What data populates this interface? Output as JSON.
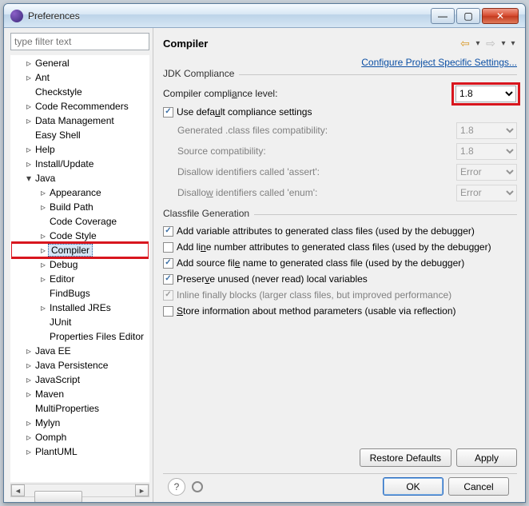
{
  "window": {
    "title": "Preferences"
  },
  "filter": {
    "placeholder": "type filter text"
  },
  "tree": {
    "items": [
      {
        "label": "General",
        "caret": ">",
        "depth": 1
      },
      {
        "label": "Ant",
        "caret": ">",
        "depth": 1
      },
      {
        "label": "Checkstyle",
        "caret": "",
        "depth": 1
      },
      {
        "label": "Code Recommenders",
        "caret": ">",
        "depth": 1
      },
      {
        "label": "Data Management",
        "caret": ">",
        "depth": 1
      },
      {
        "label": "Easy Shell",
        "caret": "",
        "depth": 1
      },
      {
        "label": "Help",
        "caret": ">",
        "depth": 1
      },
      {
        "label": "Install/Update",
        "caret": ">",
        "depth": 1
      },
      {
        "label": "Java",
        "caret": "v",
        "depth": 1
      },
      {
        "label": "Appearance",
        "caret": ">",
        "depth": 2
      },
      {
        "label": "Build Path",
        "caret": ">",
        "depth": 2
      },
      {
        "label": "Code Coverage",
        "caret": "",
        "depth": 2
      },
      {
        "label": "Code Style",
        "caret": ">",
        "depth": 2
      },
      {
        "label": "Compiler",
        "caret": ">",
        "depth": 2,
        "selected": true,
        "highlight": true
      },
      {
        "label": "Debug",
        "caret": ">",
        "depth": 2
      },
      {
        "label": "Editor",
        "caret": ">",
        "depth": 2
      },
      {
        "label": "FindBugs",
        "caret": "",
        "depth": 2
      },
      {
        "label": "Installed JREs",
        "caret": ">",
        "depth": 2
      },
      {
        "label": "JUnit",
        "caret": "",
        "depth": 2
      },
      {
        "label": "Properties Files Editor",
        "caret": "",
        "depth": 2
      },
      {
        "label": "Java EE",
        "caret": ">",
        "depth": 1
      },
      {
        "label": "Java Persistence",
        "caret": ">",
        "depth": 1
      },
      {
        "label": "JavaScript",
        "caret": ">",
        "depth": 1
      },
      {
        "label": "Maven",
        "caret": ">",
        "depth": 1
      },
      {
        "label": "MultiProperties",
        "caret": "",
        "depth": 1
      },
      {
        "label": "Mylyn",
        "caret": ">",
        "depth": 1
      },
      {
        "label": "Oomph",
        "caret": ">",
        "depth": 1
      },
      {
        "label": "PlantUML",
        "caret": ">",
        "depth": 1
      }
    ]
  },
  "page": {
    "title": "Compiler",
    "projectLink": "Configure Project Specific Settings...",
    "jdk": {
      "legend": "JDK Compliance",
      "complianceLabel_pre": "Compiler compli",
      "complianceLabel_u": "a",
      "complianceLabel_post": "nce level:",
      "complianceValue": "1.8",
      "useDefault_pre": "Use defa",
      "useDefault_u": "u",
      "useDefault_post": "lt compliance settings",
      "genClassLabel": "Generated .class files compatibility:",
      "genClassValue": "1.8",
      "sourceCompatLabel": "Source compatibility:",
      "sourceCompatValue": "1.8",
      "assertLabel": "Disallow identifiers called 'assert':",
      "assertValue": "Error",
      "enumLabel_pre": "Disallo",
      "enumLabel_u": "w",
      "enumLabel_post": " identifiers called 'enum':",
      "enumValue": "Error"
    },
    "classfile": {
      "legend": "Classfile Generation",
      "addVar": "Add variable attributes to generated class files (used by the debugger)",
      "addLine_pre": "Add li",
      "addLine_u": "n",
      "addLine_post": "e number attributes to generated class files (used by the debugger)",
      "addSrc_pre": "Add source fil",
      "addSrc_u": "e",
      "addSrc_post": " name to generated class file (used by the debugger)",
      "preserve_pre": "Preser",
      "preserve_u": "v",
      "preserve_post": "e unused (never read) local variables",
      "inline": "Inline finally blocks (larger class files, but improved performance)",
      "store_pre": "",
      "store_u": "S",
      "store_post": "tore information about method parameters (usable via reflection)"
    },
    "buttons": {
      "restore": "Restore Defaults",
      "apply": "Apply",
      "ok": "OK",
      "cancel": "Cancel"
    }
  }
}
